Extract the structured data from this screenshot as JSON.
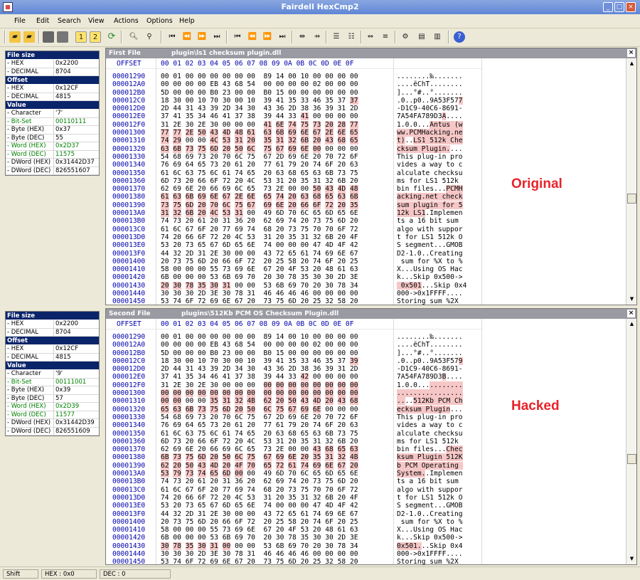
{
  "window": {
    "title": "Fairdell HexCmp2",
    "min": "_",
    "max": "□",
    "close": "×"
  },
  "menu": [
    "File",
    "Edit",
    "Search",
    "View",
    "Actions",
    "Options",
    "Help"
  ],
  "first": {
    "label": "First File",
    "file": "plugin\\ls1 checksum plugin.dll",
    "info": {
      "file_size_label": "File size",
      "hex_label": "- HEX",
      "hex_val": "0x2200",
      "dec_label": "- DECIMAL",
      "dec_val": "8704",
      "offset_label": "Offset",
      "off_hex_label": "- HEX",
      "off_hex_val": "0x12CF",
      "off_dec_label": "- DECIMAL",
      "off_dec_val": "4815",
      "value_label": "Value",
      "char_label": "- Character",
      "char_val": "'7'",
      "bitset_label": "- Bit-Set",
      "bitset_val": "00110111",
      "bytehex_label": "- Byte (HEX)",
      "bytehex_val": "0x37",
      "bytedec_label": "- Byte (DEC)",
      "bytedec_val": "55",
      "wordhex_label": "- Word (HEX)",
      "wordhex_val": "0x2D37",
      "worddec_label": "- Word (DEC)",
      "worddec_val": "11575",
      "dwordhex_label": "- DWord (HEX)",
      "dwordhex_val": "0x31442D37",
      "dworddec_label": "- DWord (DEC)",
      "dworddec_val": "826551607"
    },
    "offsets": [
      "00001290",
      "000012A0",
      "000012B0",
      "000012C0",
      "000012D0",
      "000012E0",
      "000012F0",
      "00001300",
      "00001310",
      "00001320",
      "00001330",
      "00001340",
      "00001350",
      "00001360",
      "00001370",
      "00001380",
      "00001390",
      "000013A0",
      "000013B0",
      "000013C0",
      "000013D0",
      "000013E0",
      "000013F0",
      "00001400",
      "00001410",
      "00001420",
      "00001430",
      "00001440",
      "00001450"
    ],
    "hex": [
      "00 01 00 00 00 00 00 00  89 14 00 10 00 00 00 00",
      "00 00 00 00 EB 43 68 54  00 00 00 00 02 00 00 00",
      "5D 00 00 00 B0 23 00 00  B0 15 00 00 00 00 00 00",
      "18 30 00 10 70 30 00 10  39 41 35 33 46 35 37 37",
      "2D 44 31 43 39 2D 34 30  43 36 2D 38 36 39 31 2D",
      "37 41 35 34 46 41 37 38  39 44 33 41 00 00 00 00",
      "31 2E 30 2E 30 00 00 00  41 6E 74 75 73 20 28 77",
      "77 77 2E 50 43 4D 48 61  63 6B 69 6E 67 2E 6E 65",
      "74 29 00 00 4C 53 31 20  35 31 32 6B 20 43 68 65",
      "63 6B 73 75 6D 20 50 6C  75 67 69 6E 00 00 00 00",
      "54 68 69 73 20 70 6C 75  67 2D 69 6E 20 70 72 6F",
      "76 69 64 65 73 20 61 20  77 61 79 20 74 6F 20 63",
      "61 6C 63 75 6C 61 74 65  20 63 68 65 63 6B 73 75",
      "6D 73 20 66 6F 72 20 4C  53 31 20 35 31 32 6B 20",
      "62 69 6E 20 66 69 6C 65  73 2E 00 00 50 43 4D 48",
      "61 63 6B 69 6E 67 2E 6E  65 74 20 63 68 65 63 6B",
      "73 75 6D 20 70 6C 75 67  69 6E 20 66 6F 72 20 35",
      "31 32 6B 20 4C 53 31 00  49 6D 70 6C 65 6D 65 6E",
      "74 73 20 61 20 31 36 20  62 69 74 20 73 75 6D 20",
      "61 6C 67 6F 20 77 69 74  68 20 73 75 70 70 6F 72",
      "74 20 66 6F 72 20 4C 53  31 20 35 31 32 6B 20 4F",
      "53 20 73 65 67 6D 65 6E  74 00 00 00 47 4D 4F 42",
      "44 32 2D 31 2E 30 00 00  43 72 65 61 74 69 6E 67",
      "20 73 75 6D 20 66 6F 72  20 25 58 20 74 6F 20 25",
      "58 00 00 00 55 73 69 6E  67 20 4F 53 20 48 61 63",
      "6B 00 00 00 53 6B 69 70  20 30 78 35 30 30 2D 3E",
      "20 30 78 35 30 31 00 00  53 6B 69 70 20 30 78 34",
      "30 30 30 2D 3E 30 78 31  46 46 46 46 00 00 00 00",
      "53 74 6F 72 69 6E 67 20  73 75 6D 20 25 32 58 20"
    ],
    "ascii": [
      "........‰.......",
      "....ëChT........",
      "]...°#..°.......",
      ".0..p0..9A53F577",
      "-D1C9-40C6-8691-",
      "7A54FA789D3A....",
      "1.0.0...Antus (w",
      "ww.PCMHacking.ne",
      "t)..LS1 512k Che",
      "cksum Plugin....",
      "This plug-in pro",
      "vides a way to c",
      "alculate checksu",
      "ms for LS1 512k ",
      "bin files...PCMH",
      "acking.net check",
      "sum plugin for 5",
      "12k LS1.Implemen",
      "ts a 16 bit sum ",
      "algo with suppor",
      "t for LS1 512k O",
      "S segment...GMOB",
      "D2-1.0..Creating",
      " sum for %X to %",
      "X...Using OS Hac",
      "k...Skip 0x500->",
      " 0x501...Skip 0x4",
      "000->0x1FFFF....",
      "Storing sum %2X "
    ],
    "tag": "Original"
  },
  "second": {
    "label": "Second File",
    "file": "plugins\\512Kb PCM OS Checksum Plugin.dll",
    "info": {
      "file_size_label": "File size",
      "hex_label": "- HEX",
      "hex_val": "0x2200",
      "dec_label": "- DECIMAL",
      "dec_val": "8704",
      "offset_label": "Offset",
      "off_hex_label": "- HEX",
      "off_hex_val": "0x12CF",
      "off_dec_label": "- DECIMAL",
      "off_dec_val": "4815",
      "value_label": "Value",
      "char_label": "- Character",
      "char_val": "'9'",
      "bitset_label": "- Bit-Set",
      "bitset_val": "00111001",
      "bytehex_label": "- Byte (HEX)",
      "bytehex_val": "0x39",
      "bytedec_label": "- Byte (DEC)",
      "bytedec_val": "57",
      "wordhex_label": "- Word (HEX)",
      "wordhex_val": "0x2D39",
      "worddec_label": "- Word (DEC)",
      "worddec_val": "11577",
      "dwordhex_label": "- DWord (HEX)",
      "dwordhex_val": "0x31442D39",
      "dworddec_label": "- DWord (DEC)",
      "dworddec_val": "826551609"
    },
    "offsets": [
      "00001290",
      "000012A0",
      "000012B0",
      "000012C0",
      "000012D0",
      "000012E0",
      "000012F0",
      "00001300",
      "00001310",
      "00001320",
      "00001330",
      "00001340",
      "00001350",
      "00001360",
      "00001370",
      "00001380",
      "00001390",
      "000013A0",
      "000013B0",
      "000013C0",
      "000013D0",
      "000013E0",
      "000013F0",
      "00001400",
      "00001410",
      "00001420",
      "00001430",
      "00001440",
      "00001450"
    ],
    "hex": [
      "00 01 00 00 00 00 00 00  89 14 00 10 00 00 00 00",
      "00 00 00 00 EB 43 68 54  00 00 00 00 02 00 00 00",
      "5D 00 00 00 B0 23 00 00  B0 15 00 00 00 00 00 00",
      "18 30 00 10 70 30 00 10  39 41 35 33 46 35 37 39",
      "2D 44 31 43 39 2D 34 30  43 36 2D 38 36 39 31 2D",
      "37 41 35 34 46 41 37 38  39 44 33 42 00 00 00 00",
      "31 2E 30 2E 30 00 00 00  00 00 00 00 00 00 00 00",
      "00 00 00 00 00 00 00 00  00 00 00 00 00 00 00 00",
      "00 00 00 00 35 31 32 4B  62 20 50 43 4D 20 43 68",
      "65 63 6B 73 75 6D 20 50  6C 75 67 69 6E 00 00 00",
      "54 68 69 73 20 70 6C 75  67 2D 69 6E 20 70 72 6F",
      "76 69 64 65 73 20 61 20  77 61 79 20 74 6F 20 63",
      "61 6C 63 75 6C 61 74 65  20 63 68 65 63 6B 73 75",
      "6D 73 20 66 6F 72 20 4C  53 31 20 35 31 32 6B 20",
      "62 69 6E 20 66 69 6C 65  73 2E 00 00 43 68 65 63",
      "6B 73 75 6D 20 50 6C 75  67 69 6E 20 35 31 32 4B",
      "62 20 50 43 4D 20 4F 70  65 72 61 74 69 6E 67 20",
      "53 79 73 74 65 6D 00 00  49 6D 70 6C 65 6D 65 6E",
      "74 73 20 61 20 31 36 20  62 69 74 20 73 75 6D 20",
      "61 6C 67 6F 20 77 69 74  68 20 73 75 70 70 6F 72",
      "74 20 66 6F 72 20 4C 53  31 20 35 31 32 6B 20 4F",
      "53 20 73 65 67 6D 65 6E  74 00 00 00 47 4D 4F 42",
      "44 32 2D 31 2E 30 00 00  43 72 65 61 74 69 6E 67",
      "20 73 75 6D 20 66 6F 72  20 25 58 20 74 6F 20 25",
      "58 00 00 00 55 73 69 6E  67 20 4F 53 20 48 61 63",
      "6B 00 00 00 53 6B 69 70  20 30 78 35 30 30 2D 3E",
      "30 78 35 30 31 00 00 00  53 6B 69 70 20 30 78 34",
      "30 30 30 2D 3E 30 78 31  46 46 46 46 00 00 00 00",
      "53 74 6F 72 69 6E 67 20  73 75 6D 20 25 32 58 20"
    ],
    "ascii": [
      "........‰.......",
      "....ëChT........",
      "]...°#..°.......",
      ".0..p0..9A53F579",
      "-D1C9-40C6-8691-",
      "7A54FA789D3B....",
      "1.0.0...........",
      "................",
      "....512Kb PCM Ch",
      "ecksum Plugin...",
      "This plug-in pro",
      "vides a way to c",
      "alculate checksu",
      "ms for LS1 512k ",
      "bin files...Chec",
      "ksum Plugin 512K",
      "b PCM Operating ",
      "System..Implemen",
      "ts a 16 bit sum ",
      "algo with suppor",
      "t for LS1 512k O",
      "S segment...GMOB",
      "D2-1.0..Creating",
      " sum for %X to %",
      "X...Using OS Hac",
      "k...Skip 0x500->",
      "0x501...Skip 0x4",
      "000->0x1FFFF....",
      "Storing sum %2X "
    ],
    "tag": "Hacked"
  },
  "columns": {
    "offset": "OFFSET",
    "hex": "00 01 02 03 04 05 06 07  08 09 0A 0B 0C 0D 0E 0F"
  },
  "status": {
    "shift": "Shift",
    "hex": "HEX : 0x0",
    "dec": "DEC : 0"
  },
  "colors": {
    "diff": "#f6c7c7",
    "accent": "#0a246a",
    "tag": "#e8232a"
  }
}
